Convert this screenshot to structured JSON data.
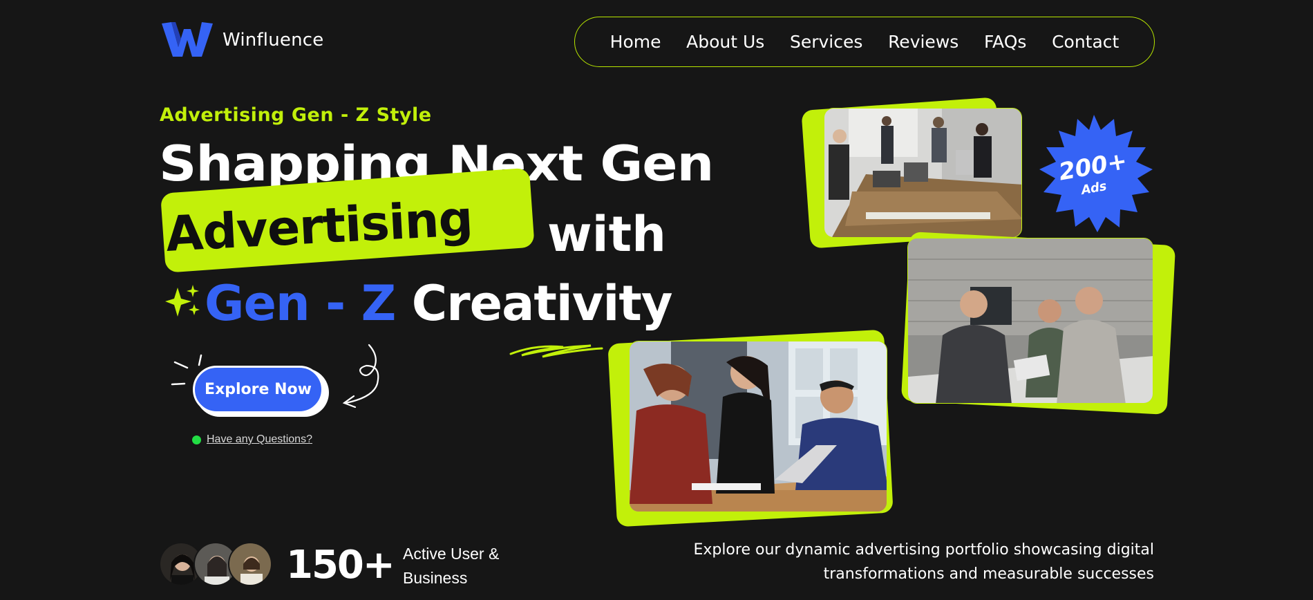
{
  "brand": {
    "name": "Winfluence",
    "accent": "#c2f00a",
    "blue": "#3563f5",
    "background": "#161616"
  },
  "nav": {
    "items": [
      "Home",
      "About Us",
      "Services",
      "Reviews",
      "FAQs",
      "Contact"
    ]
  },
  "hero": {
    "eyebrow": "Advertising Gen - Z Style",
    "line1": "Shapping Next Gen",
    "line2_highlight": "Advertising",
    "line2_rest": "with",
    "line3_gen": "Gen -",
    "line3_z": "Z",
    "line3_rest": "Creativity",
    "cta": "Explore Now",
    "question_link": "Have any Questions?"
  },
  "badge": {
    "value": "200+",
    "label": "Ads"
  },
  "stats": {
    "count": "150+",
    "label": "Active User & Business"
  },
  "portfolio_text": "Explore our dynamic advertising portfolio showcasing digital transformations and measurable successes",
  "icons": [
    "logo-w-icon",
    "sparkle-icon",
    "squiggle-decoration",
    "curly-arrow-icon",
    "starburst-badge"
  ]
}
